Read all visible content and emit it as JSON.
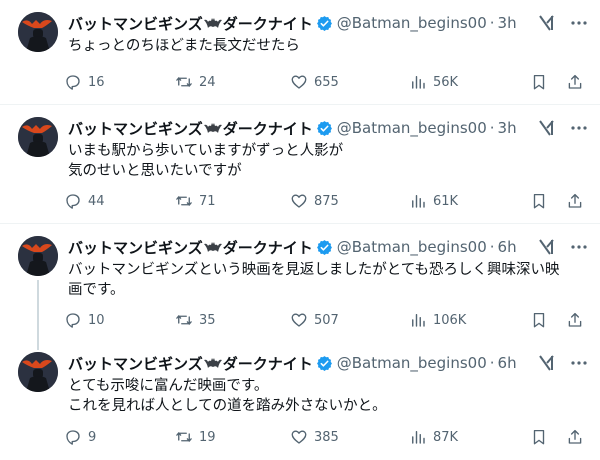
{
  "author": {
    "name_part1": "バットマンビギンズ",
    "name_part2": "ダークナイト",
    "handle": "@Batman_begins00"
  },
  "icons": {
    "reply": "reply-icon",
    "retweet": "retweet-icon",
    "like": "heart-icon",
    "views": "views-icon",
    "bookmark": "bookmark-icon",
    "share": "share-icon",
    "grok": "grok-icon",
    "more": "more-icon",
    "verified": "verified-badge-icon"
  },
  "colors": {
    "verified": "#1d9bf0",
    "secondary_text": "#536471",
    "thread_line": "#cfd9de"
  },
  "tweets": [
    {
      "time": "3h",
      "text": "ちょっとのちほどまた長文だせたら",
      "replies": "16",
      "retweets": "24",
      "likes": "655",
      "views": "56K"
    },
    {
      "time": "3h",
      "text": "いまも駅から歩いていますがずっと人影が\n気のせいと思いたいですが",
      "replies": "44",
      "retweets": "71",
      "likes": "875",
      "views": "61K"
    },
    {
      "time": "6h",
      "text": "バットマンビギンズという映画を見返しましたがとても恐ろしく興味深い映\n画です。",
      "replies": "10",
      "retweets": "35",
      "likes": "507",
      "views": "106K"
    },
    {
      "time": "6h",
      "text": "とても示唆に富んだ映画です。\nこれを見れば人としての道を踏み外さないかと。",
      "replies": "9",
      "retweets": "19",
      "likes": "385",
      "views": "87K"
    }
  ]
}
